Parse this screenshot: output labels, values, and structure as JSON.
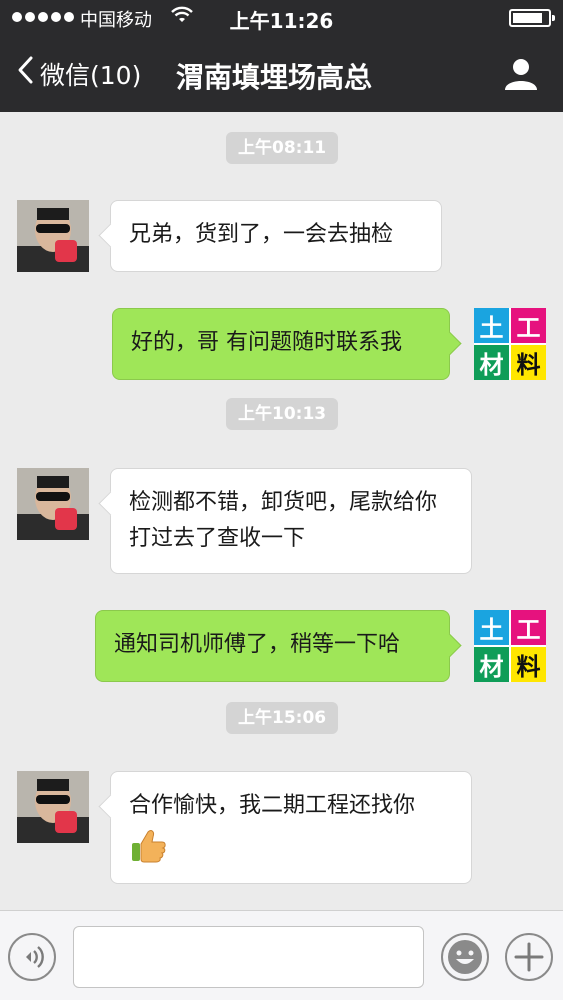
{
  "status_bar": {
    "carrier": "中国移动",
    "time": "上午11:26",
    "battery_level": 0.85
  },
  "nav": {
    "back_label": "微信(10)",
    "title": "渭南填埋场高总"
  },
  "timestamps": [
    "上午08:11",
    "上午10:13",
    "上午15:06"
  ],
  "messages": [
    {
      "direction": "incoming",
      "text": "兄弟，货到了，一会去抽检"
    },
    {
      "direction": "outgoing",
      "text": "好的，哥 有问题随时联系我"
    },
    {
      "direction": "incoming",
      "text": "检测都不错，卸货吧，尾款给你打过去了查收一下"
    },
    {
      "direction": "outgoing",
      "text": "通知司机师傅了，稍等一下哈"
    },
    {
      "direction": "incoming",
      "text": "合作愉快，我二期工程还找你",
      "emoji": "thumbs-up-icon"
    }
  ],
  "self_avatar": {
    "chars": [
      "土",
      "工",
      "材",
      "料"
    ],
    "colors": [
      "#1aa4e0",
      "#e6127e",
      "#0f9d58",
      "#ffe600"
    ]
  },
  "input": {
    "value": "",
    "placeholder": ""
  },
  "colors": {
    "header": "#2b2b2d",
    "background": "#ebebeb",
    "outgoing_bubble": "#9fe658",
    "incoming_bubble": "#ffffff"
  }
}
